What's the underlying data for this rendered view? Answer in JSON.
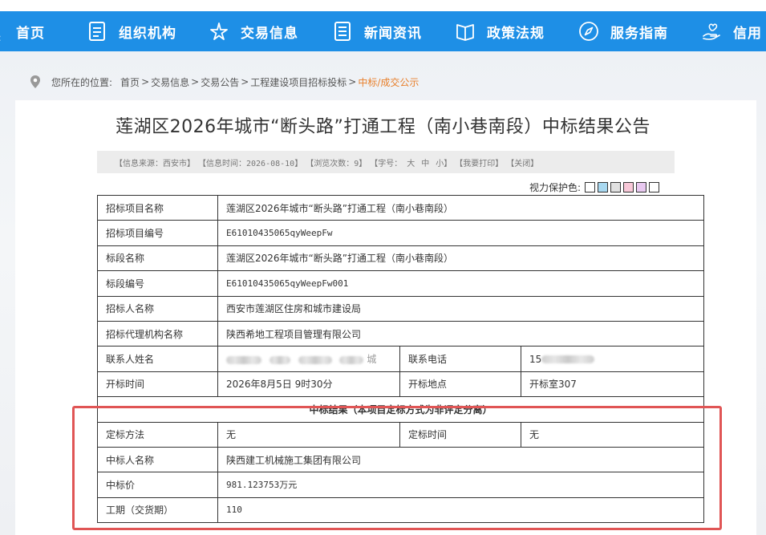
{
  "nav": {
    "items": [
      {
        "label": "首页",
        "icon": "home-icon"
      },
      {
        "label": "组织机构",
        "icon": "document-icon"
      },
      {
        "label": "交易信息",
        "icon": "star-icon"
      },
      {
        "label": "新闻资讯",
        "icon": "list-icon"
      },
      {
        "label": "政策法规",
        "icon": "book-icon"
      },
      {
        "label": "服务指南",
        "icon": "compass-icon"
      },
      {
        "label": "信用",
        "icon": "hand-icon"
      }
    ],
    "bar_color": "#1e8fe6"
  },
  "breadcrumb": {
    "prefix": "您所在的位置:",
    "items": [
      "首页",
      "交易信息",
      "交易公告",
      "工程建设项目招标投标"
    ],
    "current": "中标/成交公示",
    "sep": ">",
    "current_color": "#e87f2a"
  },
  "article": {
    "title": "莲湖区2026年城市“断头路”打通工程（南小巷南段）中标结果公告",
    "meta": {
      "source": "【信息来源：西安市】",
      "time": "【信息时间：2026-08-10】",
      "views": "【浏览次数：9】",
      "font_label": "【字号：",
      "font_sizes": [
        "大",
        "中",
        "小"
      ],
      "font_close": "】",
      "print": "【我要打印】",
      "close": "【关闭】"
    },
    "eye_protect": {
      "label": "视力保护色:",
      "colors": [
        "#ffffff",
        "#a8d8f0",
        "#e0e0e0",
        "#f8c8d8",
        "#e8c8f0",
        "#ffffff"
      ]
    }
  },
  "table": {
    "rows": [
      {
        "label": "招标项目名称",
        "value": "莲湖区2026年城市“断头路”打通工程（南小巷南段）"
      },
      {
        "label": "招标项目编号",
        "value": "E61010435065qyWeepFw"
      },
      {
        "label": "标段名称",
        "value": "莲湖区2026年城市“断头路”打通工程（南小巷南段）"
      },
      {
        "label": "标段编号",
        "value": "E61010435065qyWeepFw001"
      },
      {
        "label": "招标人名称",
        "value": "西安市莲湖区住房和城市建设局"
      },
      {
        "label": "招标代理机构名称",
        "value": "陕西希地工程项目管理有限公司"
      }
    ],
    "contact": {
      "label": "联系人姓名",
      "value_suffix": "城",
      "phone_label": "联系电话",
      "phone_prefix": "15"
    },
    "opening": {
      "label": "开标时间",
      "value": "2026年8月5日 9时30分",
      "place_label": "开标地点",
      "place_value": "开标室307"
    },
    "result_header": "中标结果（本项目定标方式为非评定分离）",
    "method": {
      "label": "定标方法",
      "value": "无",
      "time_label": "定标时间",
      "time_value": "无"
    },
    "winner": {
      "label": "中标人名称",
      "value": "陕西建工机械施工集团有限公司"
    },
    "price": {
      "label": "中标价",
      "value": "981.123753万元"
    },
    "period": {
      "label": "工期（交货期）",
      "value": "110"
    }
  },
  "highlight_color": "#e05555"
}
